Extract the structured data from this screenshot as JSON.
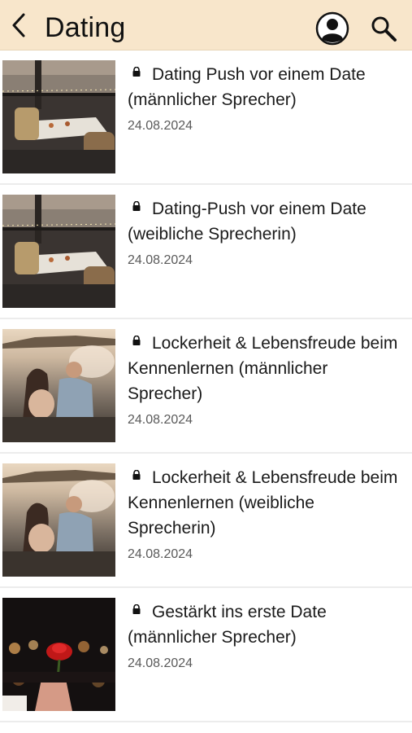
{
  "header": {
    "title": "Dating",
    "back_icon": "chevron-left-icon",
    "profile_icon": "user-circle-icon",
    "search_icon": "search-icon",
    "background_color": "#f8e6cb"
  },
  "items": [
    {
      "title": "Dating Push vor einem Date (männlicher Sprecher)",
      "date": "24.08.2024",
      "locked": true,
      "image": "rooftop-dinner-table"
    },
    {
      "title": "Dating-Push vor einem Date (weibliche Sprecherin)",
      "date": "24.08.2024",
      "locked": true,
      "image": "rooftop-dinner-table"
    },
    {
      "title": "Lockerheit & Lebensfreude beim Kennenlernen (männlicher Sprecher)",
      "date": "24.08.2024",
      "locked": true,
      "image": "couple-in-sea-sunset"
    },
    {
      "title": "Lockerheit & Lebensfreude beim Kennenlernen (weibliche Sprecherin)",
      "date": "24.08.2024",
      "locked": true,
      "image": "couple-in-sea-sunset"
    },
    {
      "title": "Gestärkt ins erste Date (männlicher Sprecher)",
      "date": "24.08.2024",
      "locked": true,
      "image": "hand-holding-red-rose"
    }
  ]
}
